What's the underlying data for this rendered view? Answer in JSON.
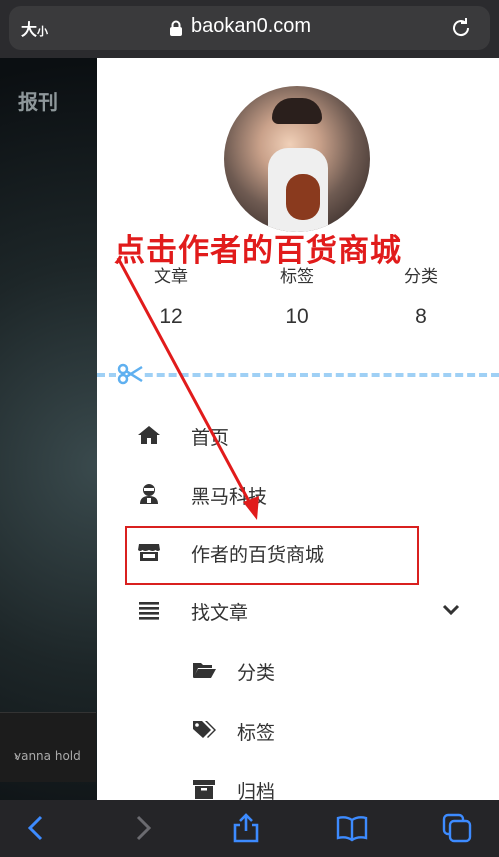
{
  "browser": {
    "text_size_label": "大",
    "text_size_small": "小",
    "url": "baokan0.com"
  },
  "background": {
    "site_title": "报刊",
    "caption": "vanna hold"
  },
  "annotation": {
    "instruction": "点击作者的百货商城"
  },
  "profile": {
    "stats": [
      {
        "label": "文章",
        "value": "12"
      },
      {
        "label": "标签",
        "value": "10"
      },
      {
        "label": "分类",
        "value": "8"
      }
    ]
  },
  "menu": {
    "items": [
      {
        "label": "首页",
        "icon": "home-icon"
      },
      {
        "label": "黑马科技",
        "icon": "user-secret-icon"
      },
      {
        "label": "作者的百货商城",
        "icon": "store-icon"
      },
      {
        "label": "找文章",
        "icon": "list-icon"
      }
    ],
    "sub_items": [
      {
        "label": "分类",
        "icon": "folder-open-icon"
      },
      {
        "label": "标签",
        "icon": "tags-icon"
      },
      {
        "label": "归档",
        "icon": "archive-icon"
      }
    ]
  },
  "colors": {
    "annotation_red": "#e11b1b",
    "divider_blue": "#9fd0f5",
    "toolbar_accent": "#3d8bff"
  }
}
